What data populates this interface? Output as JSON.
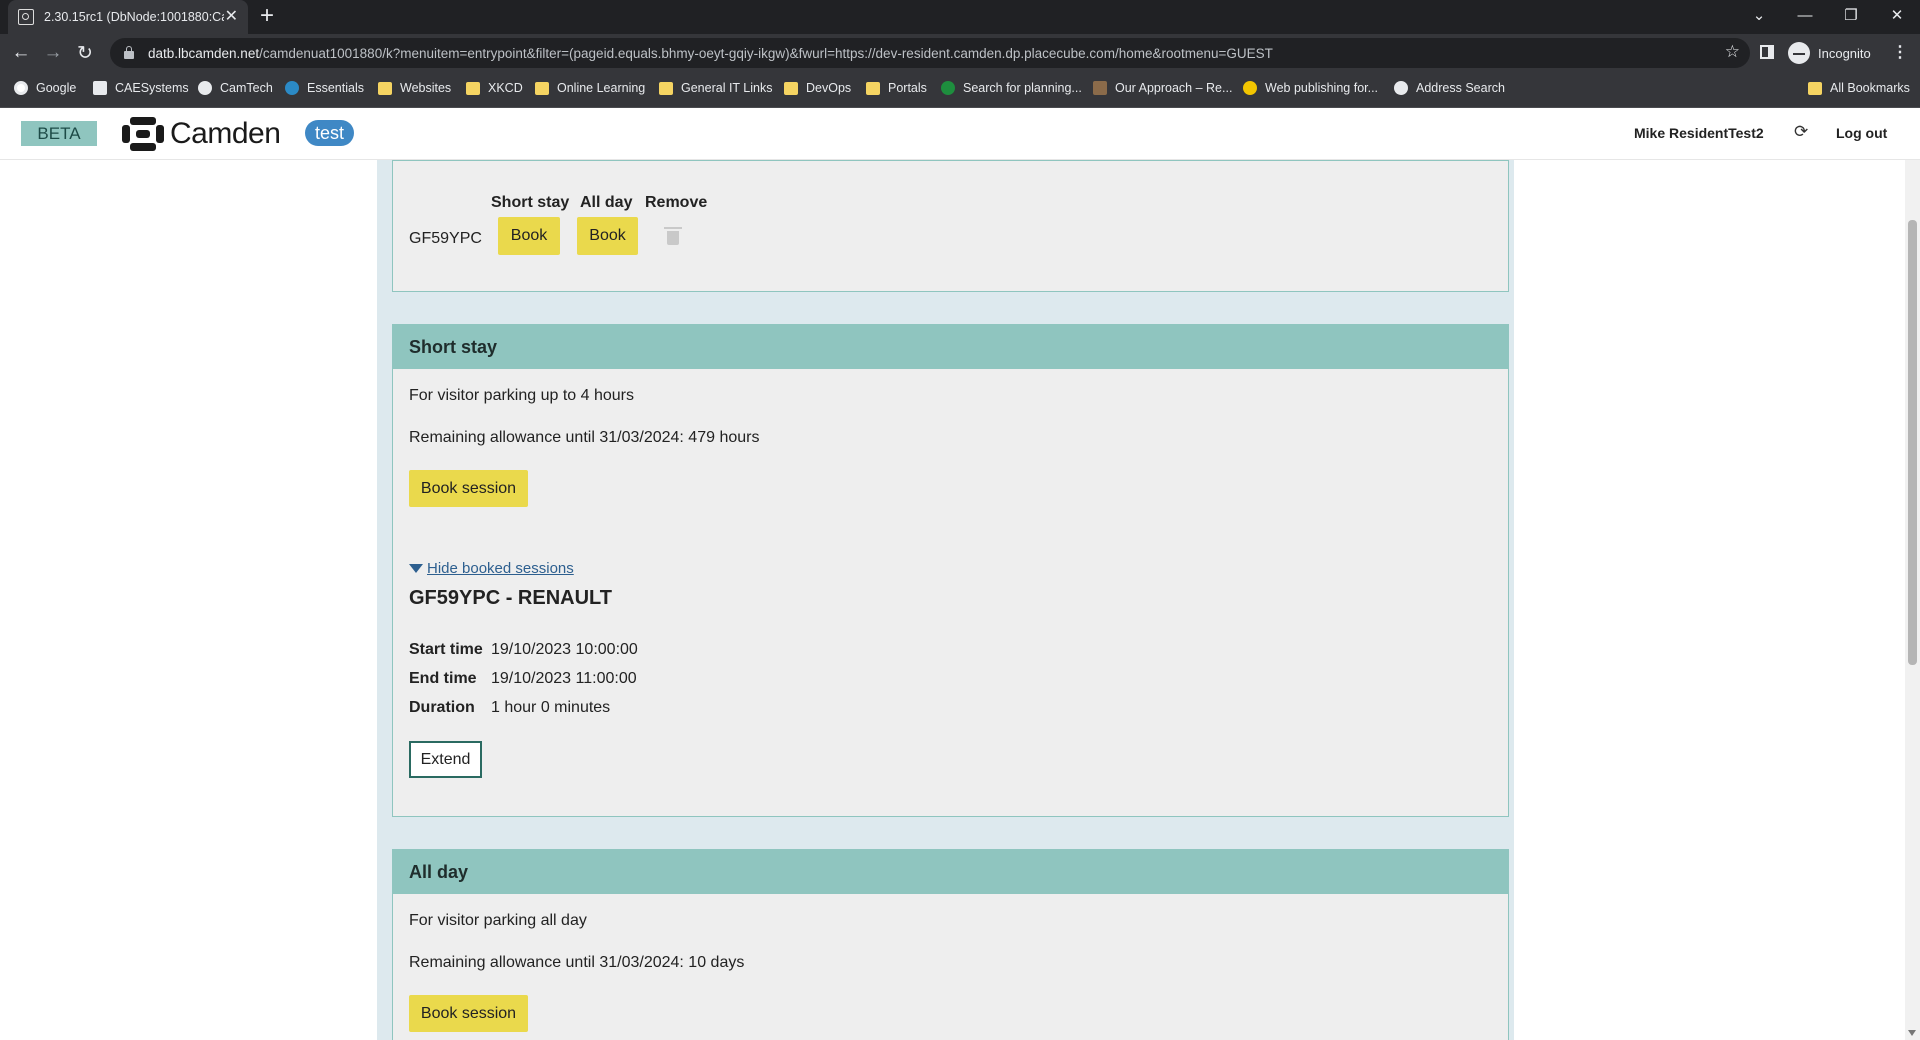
{
  "browser": {
    "tab_title": "2.30.15rc1 (DbNode:1001880:Ca",
    "url_host": "datb.lbcamden.net",
    "url_path": "/camdenuat1001880/k?menuitem=entrypoint&filter=(pageid.equals.bhmy-oeyt-gqiy-ikgw)&fwurl=https://dev-resident.camden.dp.placecube.com/home&rootmenu=GUEST",
    "profile_label": "Incognito",
    "bookmarks": [
      {
        "label": "Google",
        "icon": "google-icon"
      },
      {
        "label": "CAESystems",
        "icon": "site-icon"
      },
      {
        "label": "CamTech",
        "icon": "globe-icon"
      },
      {
        "label": "Essentials",
        "icon": "site-icon"
      },
      {
        "label": "Websites",
        "icon": "folder-icon"
      },
      {
        "label": "XKCD",
        "icon": "folder-icon"
      },
      {
        "label": "Online Learning",
        "icon": "folder-icon"
      },
      {
        "label": "General IT Links",
        "icon": "folder-icon"
      },
      {
        "label": "DevOps",
        "icon": "folder-icon"
      },
      {
        "label": "Portals",
        "icon": "folder-icon"
      },
      {
        "label": "Search for planning...",
        "icon": "site-icon"
      },
      {
        "label": "Our Approach – Re...",
        "icon": "site-icon"
      },
      {
        "label": "Web publishing for...",
        "icon": "site-icon"
      },
      {
        "label": "Address Search",
        "icon": "globe-icon"
      }
    ],
    "all_bookmarks": "All Bookmarks"
  },
  "header": {
    "beta": "BETA",
    "logo_text": "Camden",
    "env_badge": "test",
    "user_name": "Mike ResidentTest2",
    "logout": "Log out"
  },
  "vehicles_panel": {
    "columns": [
      "Short stay",
      "All day",
      "Remove"
    ],
    "rows": [
      {
        "registration": "GF59YPC",
        "short_stay_action": "Book",
        "all_day_action": "Book"
      }
    ]
  },
  "short_stay": {
    "title": "Short stay",
    "description": "For visitor parking up to 4 hours",
    "allowance": "Remaining allowance until 31/03/2024: 479 hours",
    "book_button": "Book session",
    "toggle_link": "Hide booked sessions",
    "session": {
      "vehicle": "GF59YPC - RENAULT",
      "start_label": "Start time",
      "start_value": "19/10/2023 10:00:00",
      "end_label": "End time",
      "end_value": "19/10/2023 11:00:00",
      "duration_label": "Duration",
      "duration_value": "1 hour 0 minutes",
      "extend_button": "Extend"
    }
  },
  "all_day": {
    "title": "All day",
    "description": "For visitor parking all day",
    "allowance": "Remaining allowance until 31/03/2024: 10 days",
    "book_button": "Book session"
  },
  "colors": {
    "panel_header": "#8fc5bf",
    "button_yellow": "#ead94c",
    "badge_blue": "#3f88c5",
    "content_background": "#dde9ee"
  }
}
